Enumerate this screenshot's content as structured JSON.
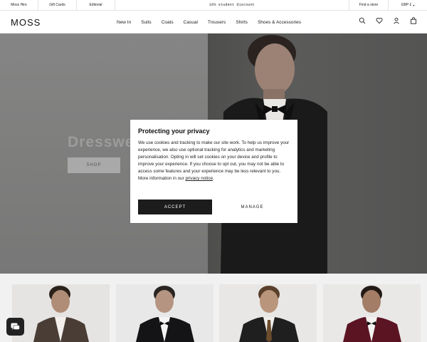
{
  "topbar": {
    "links": [
      "Moss Hire",
      "Gift Cards",
      "Editorial"
    ],
    "promo": "10% student discount",
    "store": "Find a store",
    "currency": "GBP £"
  },
  "header": {
    "logo": "MOSS",
    "nav": [
      "New In",
      "Suits",
      "Coats",
      "Casual",
      "Trousers",
      "Shirts",
      "Shoes & Accessories"
    ],
    "icons": [
      "search-icon",
      "heart-icon",
      "account-icon",
      "bag-icon"
    ]
  },
  "hero": {
    "title": "Dresswe",
    "cta": "SHOP"
  },
  "modal": {
    "title": "Protecting your privacy",
    "body": "We use cookies and tracking to make our site work. To help us improve your experience, we also use optional tracking for analytics and marketing personalisation. Opting in will set cookies on your device and profile to improve your experience. If you choose to opt out, you may not be able to access some features and your experience may be less relevant to you. More information in our",
    "link": "privacy notice",
    "period": ".",
    "accept": "ACCEPT",
    "manage": "MANAGE"
  },
  "colors": {
    "dark": "#1c1c1c",
    "hero_left": "#858585",
    "hero_right": "#545453"
  }
}
